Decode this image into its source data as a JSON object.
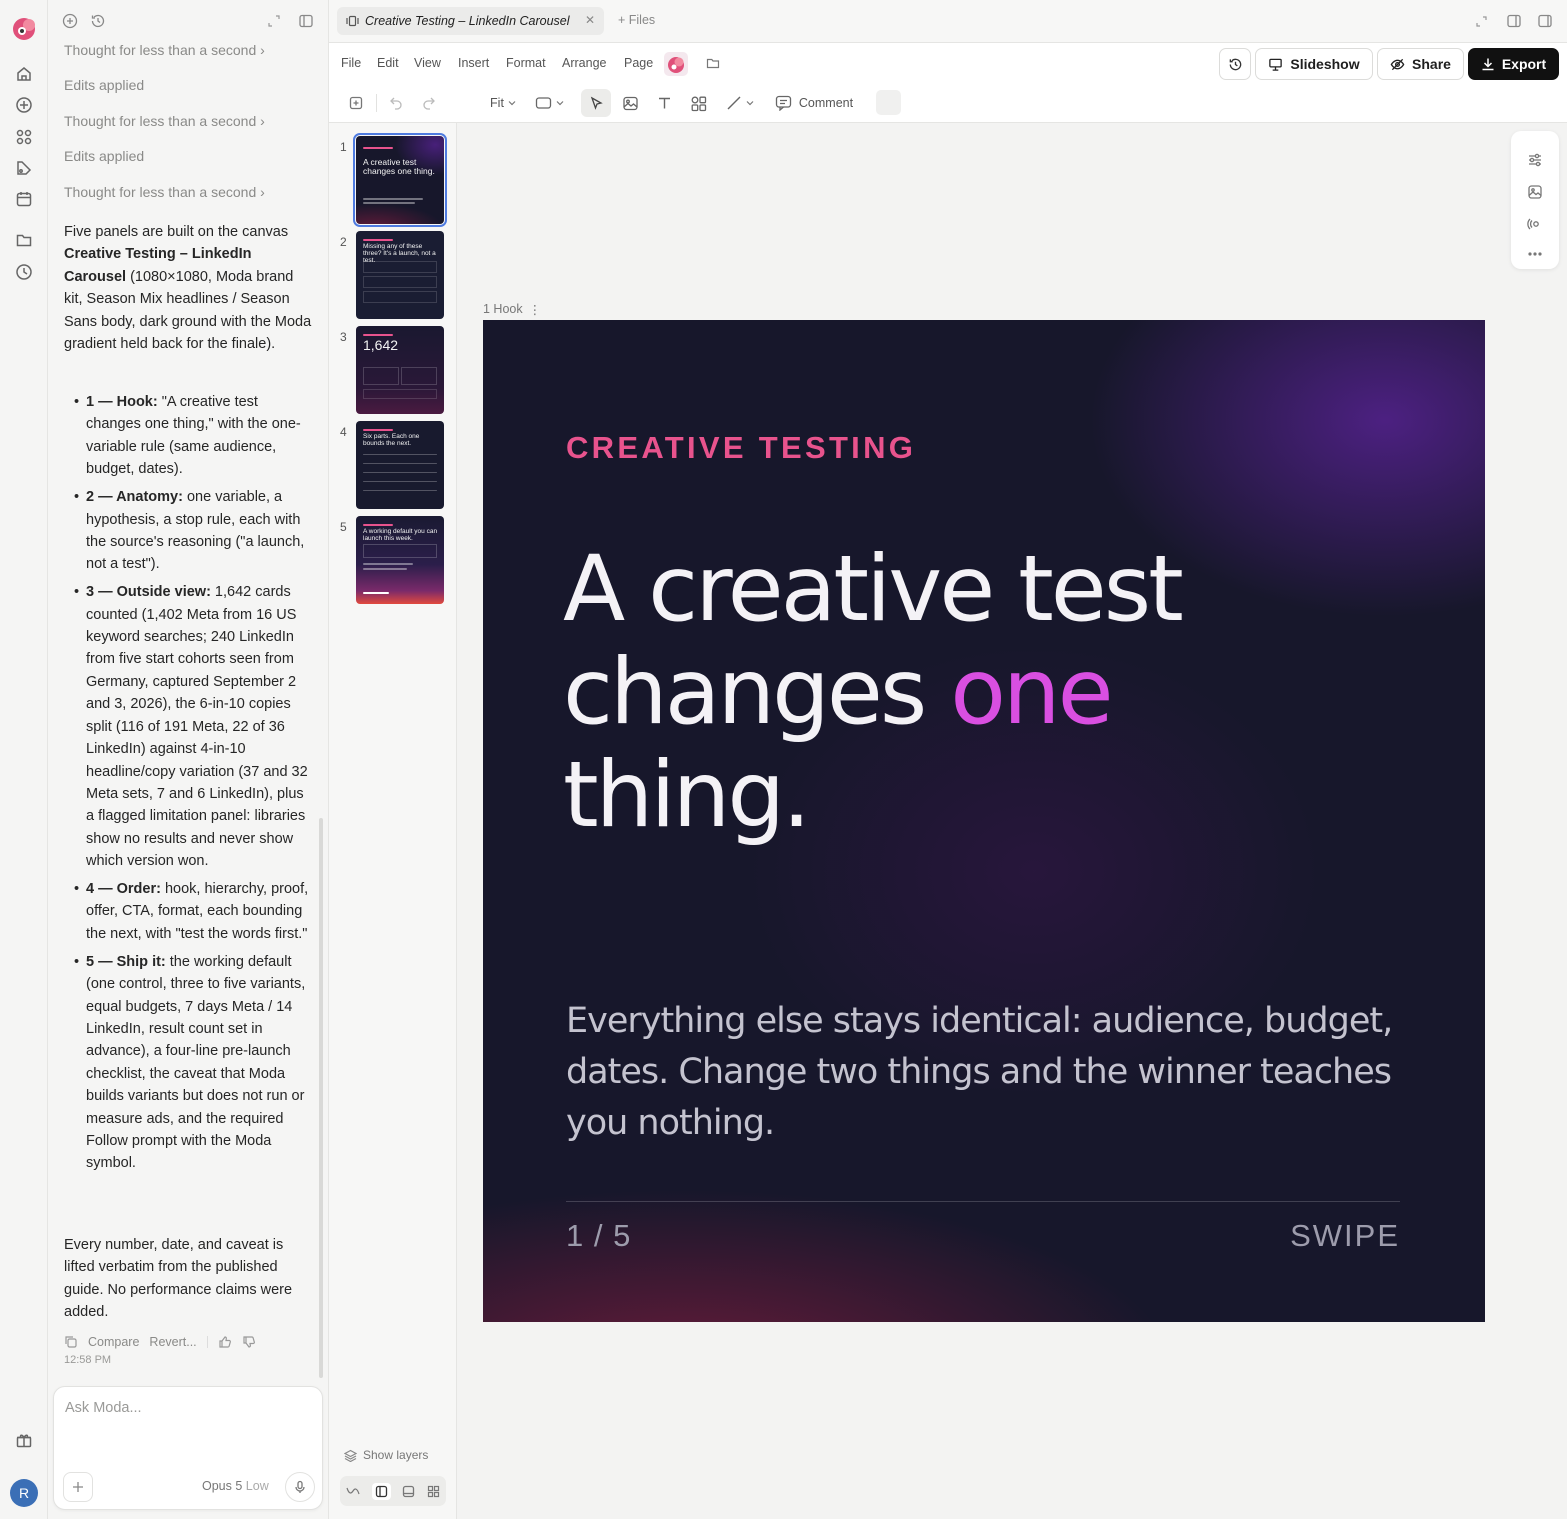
{
  "chat": {
    "thoughts": [
      {
        "text": "Thought for less than a second",
        "chevron": "›"
      },
      {
        "text": "Edits applied"
      },
      {
        "text": "Thought for less than a second",
        "chevron": "›"
      },
      {
        "text": "Edits applied"
      },
      {
        "text": "Thought for less than a second",
        "chevron": "›"
      }
    ],
    "intro": {
      "a": "Five panels are built on the canvas ",
      "b": "Creative Testing – LinkedIn Carousel",
      "c": " (1080×1080, Moda brand kit, Season Mix headlines / Season Sans body, dark ground with the Moda gradient held back for the finale)."
    },
    "bullets": [
      {
        "label": "1 — Hook:",
        "text": " \"A creative test changes one thing,\" with the one-variable rule (same audience, budget, dates)."
      },
      {
        "label": "2 — Anatomy:",
        "text": " one variable, a hypothesis, a stop rule, each with the source's reasoning (\"a launch, not a test\")."
      },
      {
        "label": "3 — Outside view:",
        "text": " 1,642 cards counted (1,402 Meta from 16 US keyword searches; 240 LinkedIn from five start cohorts seen from Germany, captured September 2 and 3, 2026), the 6-in-10 copies split (116 of 191 Meta, 22 of 36 LinkedIn) against 4-in-10 headline/copy variation (37 and 32 Meta sets, 7 and 6 LinkedIn), plus a flagged limitation panel: libraries show no results and never show which version won."
      },
      {
        "label": "4 — Order:",
        "text": " hook, hierarchy, proof, offer, CTA, format, each bounding the next, with \"test the words first.\""
      },
      {
        "label": "5 — Ship it:",
        "text": " the working default (one control, three to five variants, equal budgets, 7 days Meta / 14 LinkedIn, result count set in advance), a four-line pre-launch checklist, the caveat that Moda builds variants but does not run or measure ads, and the required Follow prompt with the Moda symbol."
      }
    ],
    "closing": "Every number, date, and caveat is lifted verbatim from the published guide. No performance claims were added.",
    "actions": {
      "compare": "Compare",
      "revert": "Revert..."
    },
    "timestamp": "12:58 PM",
    "composer": {
      "placeholder": "Ask Moda...",
      "model": "Opus 5",
      "level": "Low"
    }
  },
  "topbar": {
    "doc_tab": "Creative Testing – LinkedIn Carousel",
    "files": "+ Files"
  },
  "menu": [
    "File",
    "Edit",
    "View",
    "Insert",
    "Format",
    "Arrange",
    "Page"
  ],
  "actions": {
    "slideshow": "Slideshow",
    "share": "Share",
    "export": "Export"
  },
  "toolbar": {
    "zoom": "Fit",
    "comment": "Comment"
  },
  "thumbnails": [
    {
      "num": "1",
      "title": "A creative test changes one thing."
    },
    {
      "num": "2",
      "title": "Missing any of these three? It's a launch, not a test."
    },
    {
      "num": "3",
      "title": "1,642"
    },
    {
      "num": "4",
      "title": "Six parts. Each one bounds the next."
    },
    {
      "num": "5",
      "title": "A working default you can launch this week."
    }
  ],
  "show_layers": "Show layers",
  "frame": {
    "label": "1 Hook",
    "menu": "⋮"
  },
  "slide": {
    "eyebrow": "CREATIVE TESTING",
    "headline_a": "A creative test changes ",
    "headline_accent": "one",
    "headline_b": " thing.",
    "subcopy": "Everything else stays identical: audience, budget, dates. Change two things and the winner teaches you nothing.",
    "pager": "1 / 5",
    "swipe": "SWIPE"
  },
  "colors": {
    "accent_pink": "#e8538d",
    "accent_magenta": "#d94fe1",
    "slide_bg": "#17172b",
    "selection": "#4f7be0"
  }
}
